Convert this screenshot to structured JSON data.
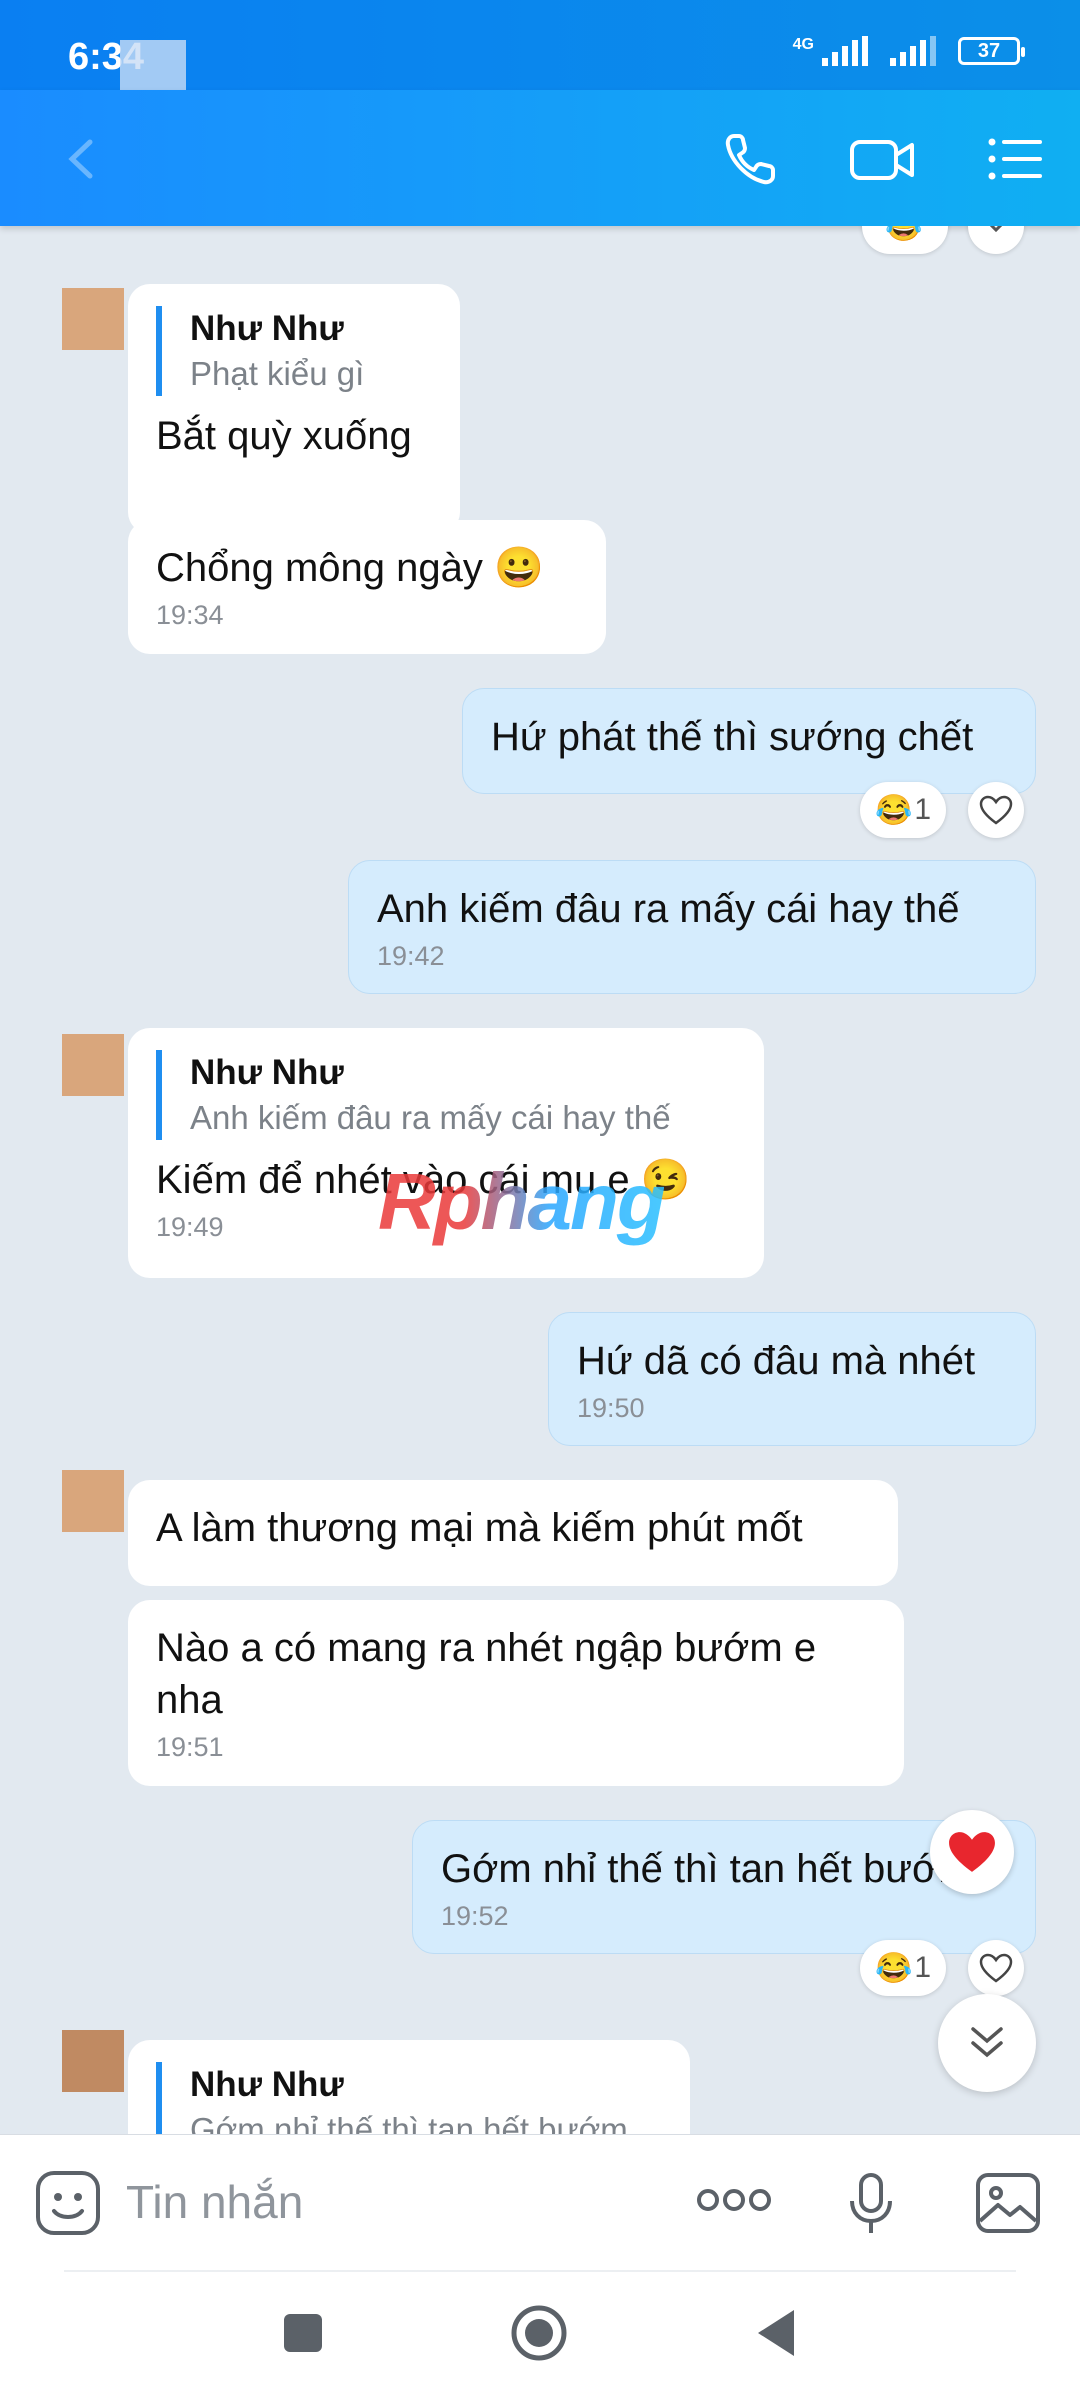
{
  "status": {
    "time": "6:34",
    "network": "4G",
    "battery": "37"
  },
  "header": {
    "icons": [
      "back-arrow-icon",
      "phone-icon",
      "video-call-icon",
      "menu-list-icon"
    ]
  },
  "messages": [
    {
      "side": "them",
      "quote_name": "Như Như",
      "quote_text": "Phạt kiểu gì",
      "text": "Bắt quỳ xuống"
    },
    {
      "side": "them",
      "text": "Chổng mông ngày 😀",
      "time": "19:34"
    },
    {
      "side": "me",
      "text": "Hứ phát thế thì sướng chết",
      "reaction_count": "1"
    },
    {
      "side": "me",
      "text": "Anh kiếm đâu ra mấy cái hay thế",
      "time": "19:42"
    },
    {
      "side": "them",
      "quote_name": "Như Như",
      "quote_text": "Anh kiếm đâu ra mấy cái hay thế",
      "text": "Kiếm để nhét vào cái mu e 😉",
      "time": "19:49"
    },
    {
      "side": "me",
      "text": "Hứ dã có đâu mà nhét",
      "time": "19:50"
    },
    {
      "side": "them",
      "text": "A làm thương mại mà kiếm phút mốt"
    },
    {
      "side": "them",
      "text": "Nào a có mang ra nhét ngập bướm e nha",
      "time": "19:51"
    },
    {
      "side": "me",
      "text": "Gớm nhỉ thế thì tan hết bướm",
      "time": "19:52",
      "reaction_count": "1"
    },
    {
      "side": "them",
      "quote_name": "Như Như",
      "quote_text": "Gớm nhỉ thế thì tan hết bướm"
    }
  ],
  "watermark": "Rphang",
  "input": {
    "placeholder": "Tin nhắn"
  },
  "colors": {
    "header": "#1a8cff",
    "my_bubble": "#d5ecfd",
    "their_bubble": "#ffffff",
    "background": "#e2e9f0",
    "quote_bar": "#1f8ef0"
  }
}
